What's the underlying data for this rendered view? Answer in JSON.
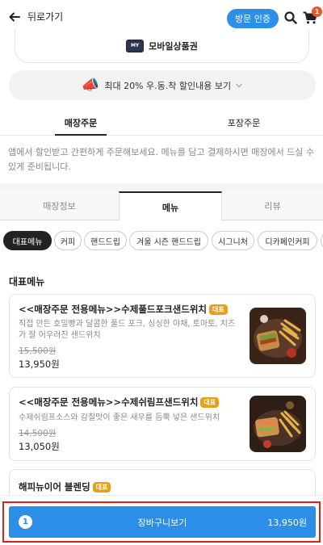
{
  "header": {
    "back_label": "뒤로가기",
    "visit_auth_label": "방문 인증",
    "cart_badge_count": "1",
    "back_icon": "arrow-left-icon",
    "search_icon": "search-icon",
    "cart_icon": "cart-icon"
  },
  "voucher": {
    "label": "모바일상품권",
    "logo_icon": "gift-voucher-icon"
  },
  "discount": {
    "label": "최대 20% 우.동.착 할인내용 보기",
    "icon": "megaphone-icon"
  },
  "order_tabs": [
    {
      "label": "매장주문",
      "active": true
    },
    {
      "label": "포장주문",
      "active": false
    }
  ],
  "notice": "앱에서 할인받고 간편하게 주문해보세요. 메뉴를 담고 결제하시면 매장에서 드실 수 있게 준비됩니다.",
  "store_tabs": [
    {
      "label": "매장정보"
    },
    {
      "label": "메뉴",
      "active": true
    },
    {
      "label": "리뷰"
    }
  ],
  "categories": [
    {
      "label": "대표메뉴",
      "active": true
    },
    {
      "label": "커피"
    },
    {
      "label": "핸드드립"
    },
    {
      "label": "겨울 시즌 핸드드립"
    },
    {
      "label": "시그니처"
    },
    {
      "label": "디카페인커피"
    }
  ],
  "section_title": "대표메뉴",
  "menu_items": [
    {
      "title": "<<매장주문 전용메뉴>>수제풀드포크샌드위치",
      "badge": "대표",
      "description": "직접 만든 호밀빵과 달콤한 풀드 포크, 싱싱한 야채, 토마토, 치즈가 잘 어우러진 샌드위치",
      "original_price": "15,500원",
      "price": "13,950원"
    },
    {
      "title": "<<매장주문 전용메뉴>>수제쉬림프샌드위치",
      "badge": "대표",
      "description": "수제쉬림프소스와 감칠맛이 좋은 새우를 듬뿍 넣은 샌드위치",
      "original_price": "14,500원",
      "price": "13,050원"
    },
    {
      "title": "해피뉴이어 블렌딩",
      "badge": "대표"
    }
  ],
  "cart_bar": {
    "count": "1",
    "label": "장바구니보기",
    "total": "13,950원"
  },
  "colors": {
    "accent_blue": "#2c8ee6",
    "badge_gold": "#e3a21a",
    "highlight_red": "#e01e1e",
    "cart_badge_orange": "#e8582a"
  }
}
